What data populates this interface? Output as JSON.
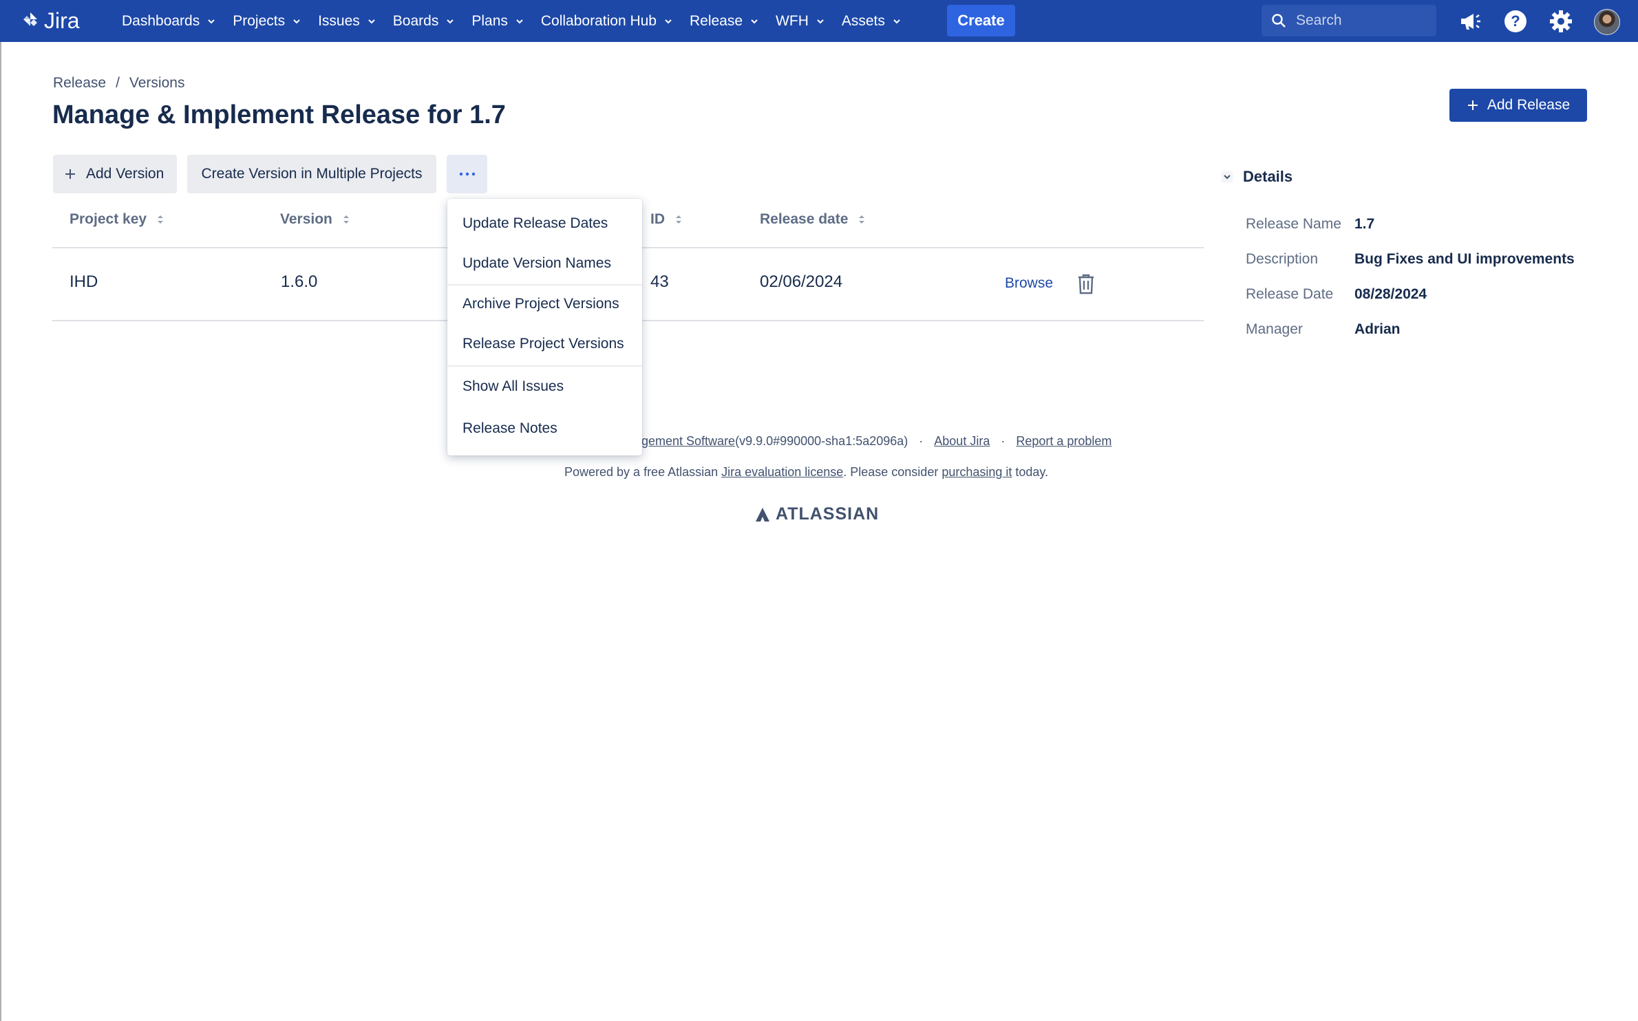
{
  "nav": {
    "logo": "Jira",
    "items": [
      "Dashboards",
      "Projects",
      "Issues",
      "Boards",
      "Plans",
      "Collaboration Hub",
      "Release",
      "WFH",
      "Assets"
    ],
    "create": "Create",
    "search_placeholder": "Search"
  },
  "breadcrumb": {
    "first": "Release",
    "sep": "/",
    "second": "Versions"
  },
  "title": "Manage & Implement Release for 1.7",
  "add_release": "Add Release",
  "toolbar": {
    "add_version": "Add Version",
    "create_multi": "Create Version in Multiple Projects",
    "more": "···"
  },
  "table": {
    "headers": [
      "Project key",
      "Version",
      "ID",
      "Release date"
    ],
    "rows": [
      {
        "project_key": "IHD",
        "version": "1.6.0",
        "id": "43",
        "release_date": "02/06/2024",
        "action": "Browse"
      }
    ]
  },
  "menu": {
    "items": [
      "Update Release Dates",
      "Update Version Names",
      "Archive Project Versions",
      "Release Project Versions",
      "Show All Issues",
      "Release Notes"
    ]
  },
  "details": {
    "title": "Details",
    "release_name_label": "Release Name",
    "release_name": "1.7",
    "description_label": "Description",
    "description": "Bug Fixes and UI improvements",
    "release_date_label": "Release Date",
    "release_date": "08/28/2024",
    "manager_label": "Manager",
    "manager": "Adrian"
  },
  "footer": {
    "line1_link": "gement Software",
    "line1_version": " (v9.9.0#990000-sha1:5a2096a)",
    "dot": "·",
    "about": "About Jira",
    "report": "Report a problem",
    "line2_a": "Powered by a free Atlassian ",
    "line2_link1": "Jira evaluation license",
    "line2_b": ". Please consider ",
    "line2_link2": "purchasing it",
    "line2_c": " today.",
    "brand": "ATLASSIAN"
  },
  "colors": {
    "nav_bg": "#1d48a8",
    "create_bg": "#2e64e0",
    "link": "#1d48a8"
  }
}
